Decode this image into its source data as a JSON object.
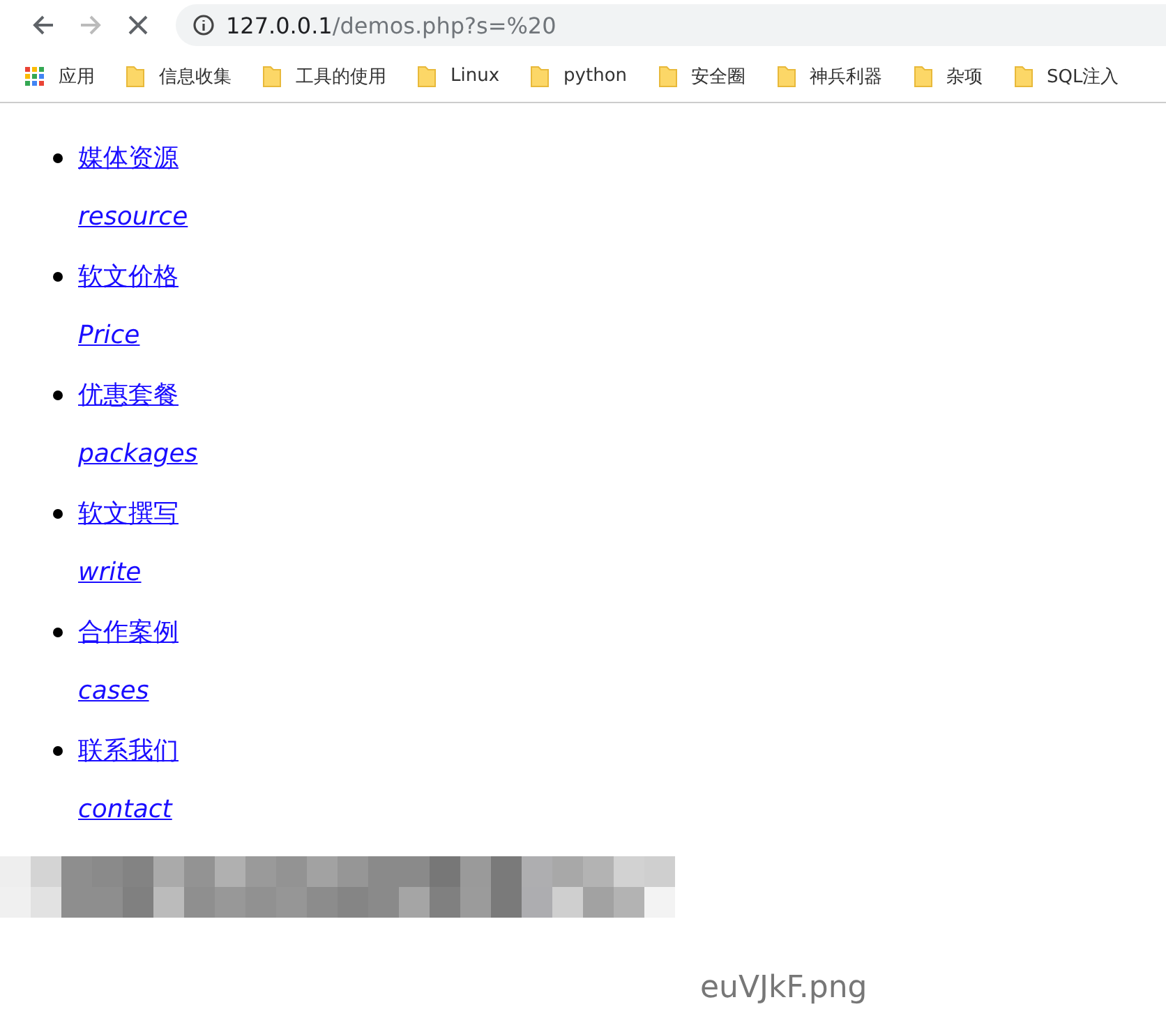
{
  "browser": {
    "url_host": "127.0.0.1",
    "url_path": "/demos.php?s=%20",
    "loading": true
  },
  "bookmarks": [
    {
      "label": "应用",
      "kind": "apps"
    },
    {
      "label": "信息收集",
      "kind": "folder"
    },
    {
      "label": "工具的使用",
      "kind": "folder"
    },
    {
      "label": "Linux",
      "kind": "folder"
    },
    {
      "label": "python",
      "kind": "folder"
    },
    {
      "label": "安全圈",
      "kind": "folder"
    },
    {
      "label": "神兵利器",
      "kind": "folder"
    },
    {
      "label": "杂项",
      "kind": "folder"
    },
    {
      "label": "SQL注入",
      "kind": "folder"
    }
  ],
  "nav_items": [
    {
      "title": "媒体资源",
      "subtitle": "resource"
    },
    {
      "title": "软文价格",
      "subtitle": "Price"
    },
    {
      "title": "优惠套餐",
      "subtitle": "packages"
    },
    {
      "title": "软文撰写",
      "subtitle": "write"
    },
    {
      "title": "合作案例",
      "subtitle": "cases"
    },
    {
      "title": "联系我们",
      "subtitle": "contact"
    }
  ],
  "image_caption": "euVJkF.png"
}
